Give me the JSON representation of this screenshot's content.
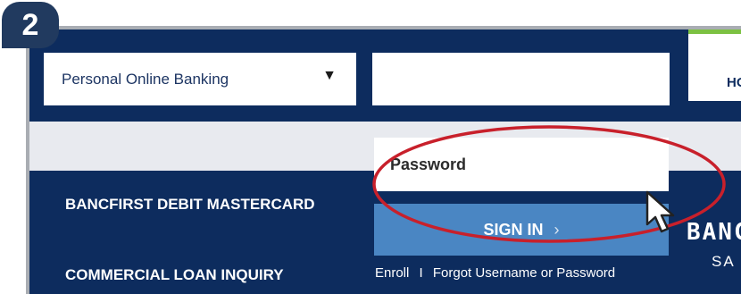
{
  "step": {
    "number": "2"
  },
  "login": {
    "account_type": "Personal Online Banking",
    "username_value": "",
    "password_label": "Password",
    "signin_label": "SIGN IN",
    "signin_chevron": "›",
    "enroll_label": "Enroll",
    "separator": "I",
    "forgot_label": "Forgot Username or Password"
  },
  "nav": {
    "partial_label": "HO"
  },
  "menu": {
    "items": [
      "BANCFIRST DEBIT MASTERCARD",
      "COMMERCIAL LOAN INQUIRY"
    ]
  },
  "brand": {
    "partial_text": "BANC",
    "partial_sub": "SA"
  },
  "colors": {
    "navy": "#0d2c5e",
    "signin_blue": "#4a86c3",
    "highlight_red": "#c8202b",
    "accent_green": "#7cc142"
  },
  "icons": {
    "dropdown": "triangle-down-icon",
    "cursor": "mouse-pointer-icon"
  }
}
